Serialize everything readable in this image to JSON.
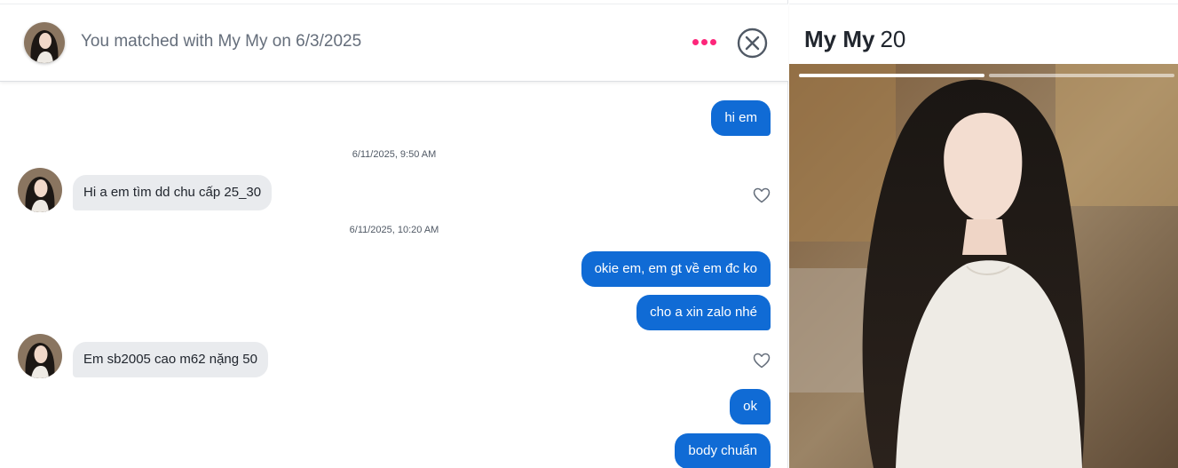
{
  "header": {
    "match_text": "You matched with My My on 6/3/2025",
    "more_icon": "more-dots-icon",
    "close_icon": "close-circle-icon",
    "accent_color": "#fd267a"
  },
  "messages": [
    {
      "type": "out",
      "text": "hi em"
    },
    {
      "type": "timestamp",
      "text": "6/11/2025, 9:50 AM"
    },
    {
      "type": "in",
      "text": "Hi a em tìm dd chu cấp 25_30"
    },
    {
      "type": "timestamp",
      "text": "6/11/2025, 10:20 AM"
    },
    {
      "type": "out",
      "text": "okie em, em gt về em đc ko"
    },
    {
      "type": "out",
      "text": "cho a xin zalo nhé"
    },
    {
      "type": "in",
      "text": "Em sb2005 cao m62 nặng 50"
    },
    {
      "type": "out",
      "text": "ok"
    },
    {
      "type": "out",
      "text": "body chuẩn"
    }
  ],
  "colors": {
    "outgoing_bubble": "#106bd5",
    "incoming_bubble": "#e9ebee"
  },
  "profile": {
    "name": "My My",
    "age": "20",
    "photo_count": 2,
    "active_photo": 1
  }
}
